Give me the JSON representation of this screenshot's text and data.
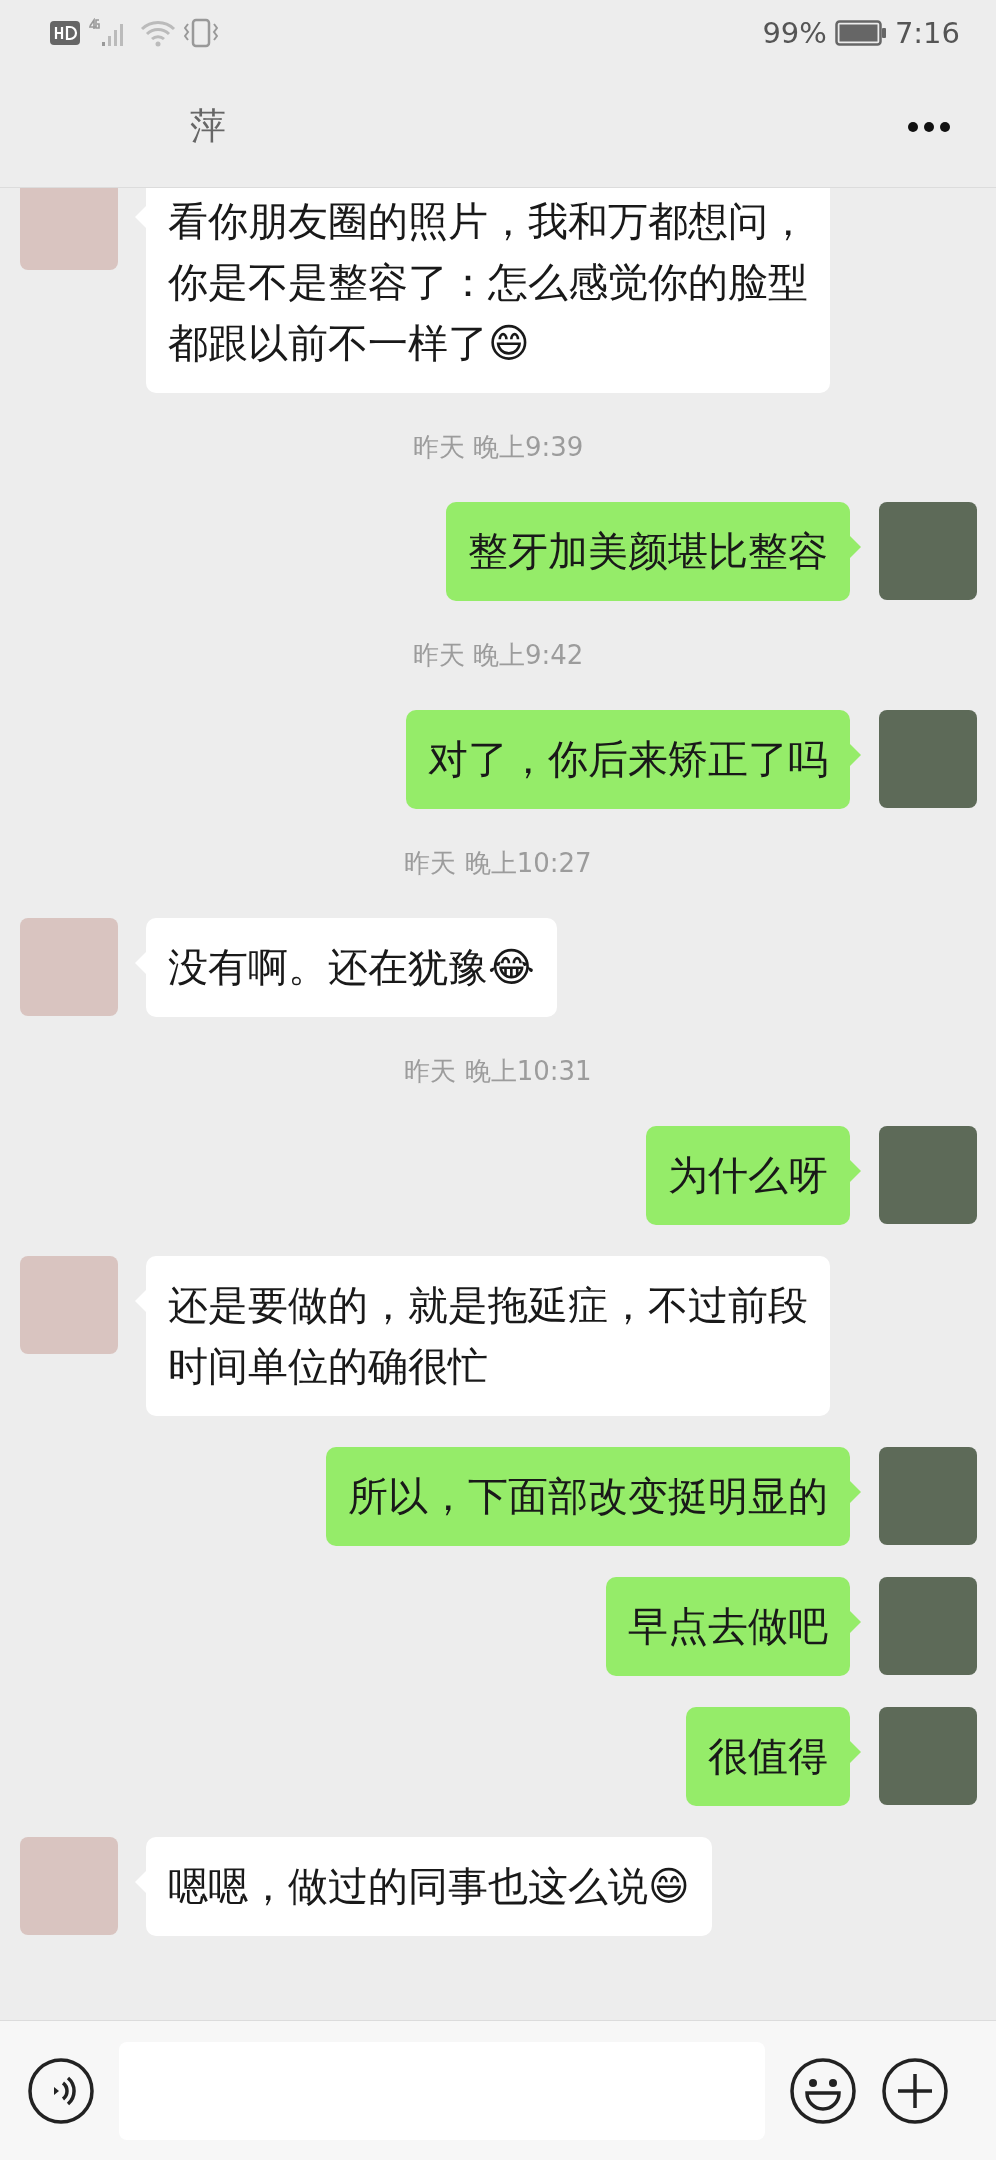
{
  "status_bar": {
    "battery_text": "99%",
    "time": "7:16"
  },
  "header": {
    "title": "萍"
  },
  "messages": [
    {
      "kind": "message",
      "outgoing": false,
      "text": "看你朋友圈的照片，我和万都想问，你是不是整容了：怎么感觉你的脸型都跟以前不一样了😄"
    },
    {
      "kind": "time",
      "text": "昨天 晚上9:39"
    },
    {
      "kind": "message",
      "outgoing": true,
      "text": "整牙加美颜堪比整容"
    },
    {
      "kind": "time",
      "text": "昨天 晚上9:42"
    },
    {
      "kind": "message",
      "outgoing": true,
      "text": "对了，你后来矫正了吗"
    },
    {
      "kind": "time",
      "text": "昨天 晚上10:27"
    },
    {
      "kind": "message",
      "outgoing": false,
      "text": "没有啊。还在犹豫😂"
    },
    {
      "kind": "time",
      "text": "昨天 晚上10:31"
    },
    {
      "kind": "message",
      "outgoing": true,
      "text": "为什么呀"
    },
    {
      "kind": "message",
      "outgoing": false,
      "text": "还是要做的，就是拖延症，不过前段时间单位的确很忙"
    },
    {
      "kind": "message",
      "outgoing": true,
      "text": "所以，下面部改变挺明显的"
    },
    {
      "kind": "message",
      "outgoing": true,
      "text": "早点去做吧"
    },
    {
      "kind": "message",
      "outgoing": true,
      "text": "很值得"
    },
    {
      "kind": "message",
      "outgoing": false,
      "text": "嗯嗯，做过的同事也这么说😄"
    }
  ]
}
